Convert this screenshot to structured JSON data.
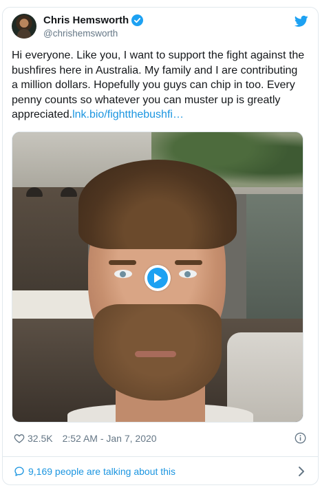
{
  "user": {
    "name": "Chris Hemsworth",
    "handle": "@chrishemsworth",
    "verified_icon": "verified-badge-icon"
  },
  "tweet": {
    "text": "Hi everyone. Like you, I want to support the fight against the bushfires here in Australia. My family and I are contributing a million dollars. Hopefully you guys can chip in too. Every penny counts so whatever you can muster up is greatly appreciated.",
    "link_text": "lnk.bio/fightthebushfi…"
  },
  "media": {
    "type": "video",
    "play_icon": "play-icon"
  },
  "meta": {
    "likes": "32.5K",
    "timestamp": "2:52 AM - Jan 7, 2020"
  },
  "footer": {
    "talking": "9,169 people are talking about this"
  },
  "colors": {
    "accent": "#1da1f2",
    "link": "#1b95e0",
    "secondary_text": "#657786",
    "border": "#e1e8ed"
  }
}
